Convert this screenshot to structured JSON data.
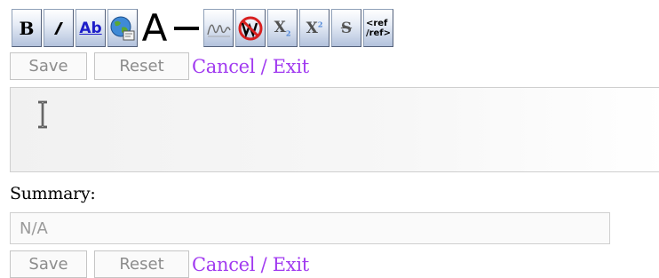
{
  "toolbar": {
    "buttons": [
      {
        "name": "bold-button",
        "icon": "bold-icon",
        "glyph": "B"
      },
      {
        "name": "italic-button",
        "icon": "italic-icon"
      },
      {
        "name": "link-button",
        "icon": "internal-link-icon",
        "glyph": "Ab"
      },
      {
        "name": "external-link-button",
        "icon": "globe-link-icon"
      },
      {
        "name": "headline-button",
        "icon": "headline-icon",
        "glyph": "A"
      },
      {
        "name": "horizontal-line-button",
        "icon": "horizontal-line-icon"
      },
      {
        "name": "signature-button",
        "icon": "signature-icon"
      },
      {
        "name": "nowiki-button",
        "icon": "no-wiki-icon"
      },
      {
        "name": "subscript-button",
        "icon": "subscript-icon",
        "glyph": "X",
        "sub": "2"
      },
      {
        "name": "superscript-button",
        "icon": "superscript-icon",
        "glyph": "X",
        "sup": "2"
      },
      {
        "name": "strikethrough-button",
        "icon": "strikethrough-icon",
        "glyph": "S"
      },
      {
        "name": "reference-button",
        "icon": "reference-icon",
        "glyph_line1": "<ref",
        "glyph_line2": "/ref>"
      }
    ]
  },
  "actions_top": {
    "save_label": "Save",
    "reset_label": "Reset",
    "cancel_label": "Cancel / Exit"
  },
  "editor": {
    "value": "",
    "cursor_icon": "text-cursor-icon"
  },
  "summary": {
    "label": "Summary:",
    "value": "N/A"
  },
  "actions_bottom": {
    "save_label": "Save",
    "reset_label": "Reset",
    "cancel_label": "Cancel / Exit"
  },
  "colors": {
    "link": "#a13bf0",
    "button_text": "#8c8c8c",
    "toolbar_blue": "#b3c2dc"
  }
}
